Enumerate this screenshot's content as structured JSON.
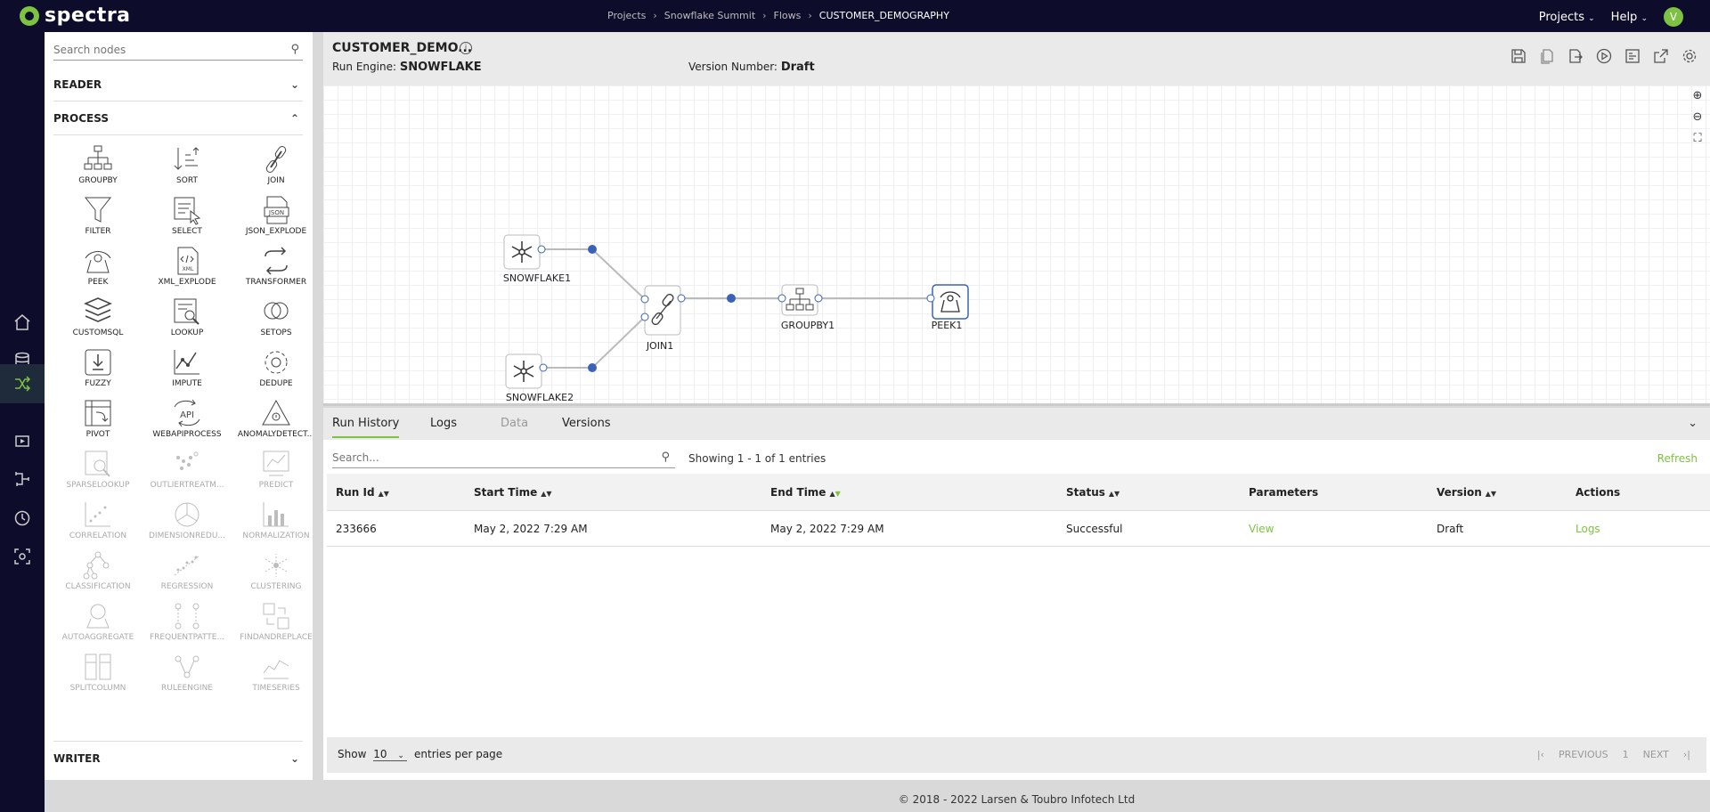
{
  "brand": {
    "name": "spectra"
  },
  "breadcrumb": [
    "Projects",
    "Snowflake Summit",
    "Flows",
    "CUSTOMER_DEMOGRAPHY"
  ],
  "topnav": {
    "projects": "Projects",
    "help": "Help",
    "avatar": "V"
  },
  "node_panel": {
    "search_placeholder": "Search nodes",
    "sections": {
      "reader": "READER",
      "process": "PROCESS",
      "writer": "WRITER"
    },
    "nodes": [
      "GROUPBY",
      "SORT",
      "JOIN",
      "FILTER",
      "SELECT",
      "JSON_EXPLODE",
      "PEEK",
      "XML_EXPLODE",
      "TRANSFORMER",
      "CUSTOMSQL",
      "LOOKUP",
      "SETOPS",
      "FUZZY",
      "IMPUTE",
      "DEDUPE",
      "PIVOT",
      "WEBAPIPROCESS",
      "ANOMALYDETECT...",
      "SPARSELOOKUP",
      "OUTLIERTREATM...",
      "PREDICT",
      "CORRELATION",
      "DIMENSIONREDU...",
      "NORMALIZATION",
      "CLASSIFICATION",
      "REGRESSION",
      "CLUSTERING",
      "AUTOAGGREGATE",
      "FREQUENTPATTE...",
      "FINDANDREPLACE",
      "SPLITCOLUMN",
      "RULEENGINE",
      "TIMESERIES"
    ]
  },
  "flow": {
    "title": "CUSTOMER_DEMO...",
    "run_engine_label": "Run Engine:",
    "run_engine": "SNOWFLAKE",
    "version_label": "Version Number:",
    "version": "Draft"
  },
  "canvas_nodes": {
    "snowflake1": "SNOWFLAKE1",
    "snowflake2": "SNOWFLAKE2",
    "join1": "JOIN1",
    "groupby1": "GROUPBY1",
    "peek1": "PEEK1"
  },
  "bottom": {
    "tabs": [
      "Run History",
      "Logs",
      "Data",
      "Versions"
    ],
    "search_placeholder": "Search...",
    "showing": "Showing 1 - 1 of 1 entries",
    "refresh": "Refresh",
    "columns": [
      "Run Id",
      "Start Time",
      "End Time",
      "Status",
      "Parameters",
      "Version",
      "Actions"
    ],
    "rows": [
      [
        "233666",
        "May 2, 2022 7:29 AM",
        "May 2, 2022 7:29 AM",
        "Successful",
        "View",
        "Draft",
        "Logs"
      ]
    ],
    "pager": {
      "show": "Show",
      "per_page_value": "10",
      "per_page": "entries per page",
      "previous": "PREVIOUS",
      "page": "1",
      "next": "NEXT"
    }
  },
  "footer": "© 2018 - 2022 Larsen & Toubro Infotech Ltd",
  "colors": {
    "accent": "#7dc242",
    "nav_bg": "#0d0d2b",
    "port": "#3a63b8"
  }
}
